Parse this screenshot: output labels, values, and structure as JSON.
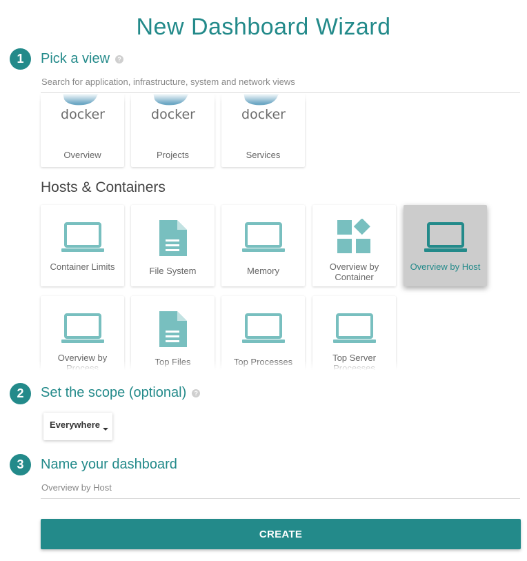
{
  "title": "New Dashboard Wizard",
  "steps": [
    {
      "number": "1",
      "label": "Pick a view"
    },
    {
      "number": "2",
      "label": "Set the scope (optional)"
    },
    {
      "number": "3",
      "label": "Name your dashboard"
    }
  ],
  "search": {
    "placeholder": "Search for application, infrastructure, system and network views",
    "value": ""
  },
  "docker_tiles": [
    {
      "logo_text": "docker",
      "label": "Overview"
    },
    {
      "logo_text": "docker",
      "label": "Projects"
    },
    {
      "logo_text": "docker",
      "label": "Services"
    }
  ],
  "hosts_section": {
    "title": "Hosts & Containers",
    "tiles": [
      {
        "icon": "laptop-icon",
        "label": "Container Limits",
        "selected": false
      },
      {
        "icon": "file-icon",
        "label": "File System",
        "selected": false
      },
      {
        "icon": "laptop-icon",
        "label": "Memory",
        "selected": false
      },
      {
        "icon": "blocks-icon",
        "label": "Overview by Container",
        "selected": false
      },
      {
        "icon": "laptop-icon",
        "label": "Overview by Host",
        "selected": true
      },
      {
        "icon": "laptop-icon",
        "label": "Overview by Process",
        "selected": false
      },
      {
        "icon": "file-icon",
        "label": "Top Files",
        "selected": false
      },
      {
        "icon": "laptop-icon",
        "label": "Top Processes",
        "selected": false
      },
      {
        "icon": "laptop-icon",
        "label": "Top Server Processes",
        "selected": false
      }
    ]
  },
  "scope": {
    "selected": "Everywhere"
  },
  "dashboard_name": {
    "placeholder": "Overview by Host",
    "value": ""
  },
  "create_button": "CREATE",
  "colors": {
    "accent": "#238a8a",
    "icon": "#78bfbf",
    "selected_tile": "#cccccc"
  }
}
